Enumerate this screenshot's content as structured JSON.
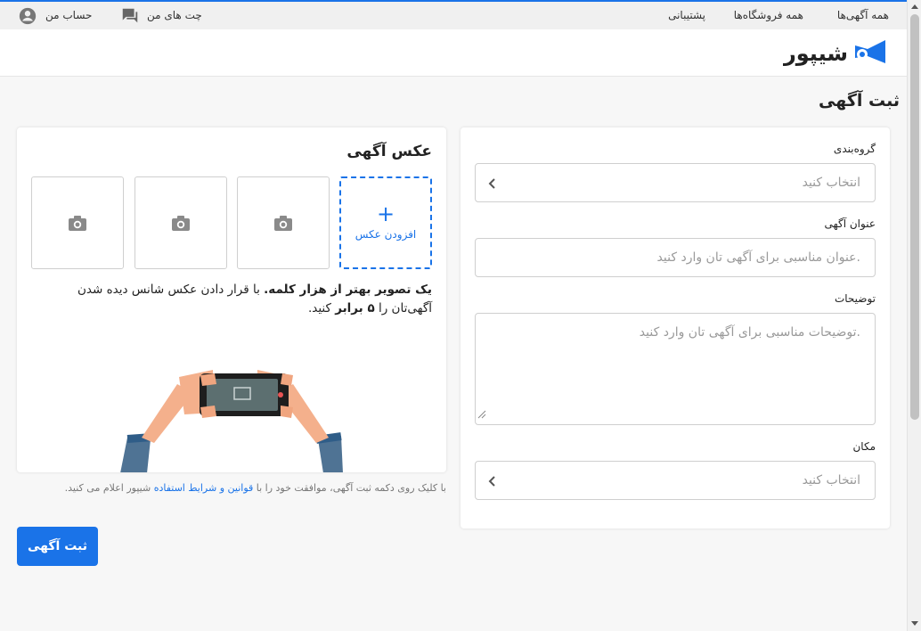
{
  "topbar": {
    "nav": [
      {
        "label": "همه آگهی‌ها"
      },
      {
        "label": "همه فروشگاه‌ها"
      },
      {
        "label": "پشتیبانی"
      }
    ],
    "chats_label": "چت های من",
    "account_label": "حساب من"
  },
  "logo": {
    "text": "شیپور",
    "icon": "horn-icon"
  },
  "page_title": "ثبت آگهی",
  "form": {
    "category": {
      "label": "گروه‌بندی",
      "placeholder": "انتخاب کنید"
    },
    "title": {
      "label": "عنوان آگهی",
      "placeholder": "عنوان مناسبی برای آگهی تان وارد کنید."
    },
    "description": {
      "label": "توضیحات",
      "placeholder": "توضیحات مناسبی برای آگهی تان وارد کنید."
    },
    "location": {
      "label": "مکان",
      "placeholder": "انتخاب کنید"
    }
  },
  "photos": {
    "title": "عکس آگهی",
    "add_label": "افزودن عکس",
    "add_symbol": "+",
    "slots": [
      "camera-icon",
      "camera-icon",
      "camera-icon"
    ],
    "promo": {
      "bold1": "یک تصویر بهتر از هزار کلمه.",
      "text1": " با قرار دادن عکس شانس دیده شدن آگهی‌تان را ",
      "bold2": "۵ برابر",
      "text2": " کنید."
    }
  },
  "terms": {
    "before": "با کلیک روی دکمه ثبت آگهی، موافقت خود را با ",
    "link": "قوانین و شرایط استفاده",
    "after": " شیپور اعلام می کنید."
  },
  "submit_label": "ثبت آگهی",
  "colors": {
    "accent": "#1a73e8",
    "background": "#f7f7f7",
    "card": "#ffffff"
  }
}
